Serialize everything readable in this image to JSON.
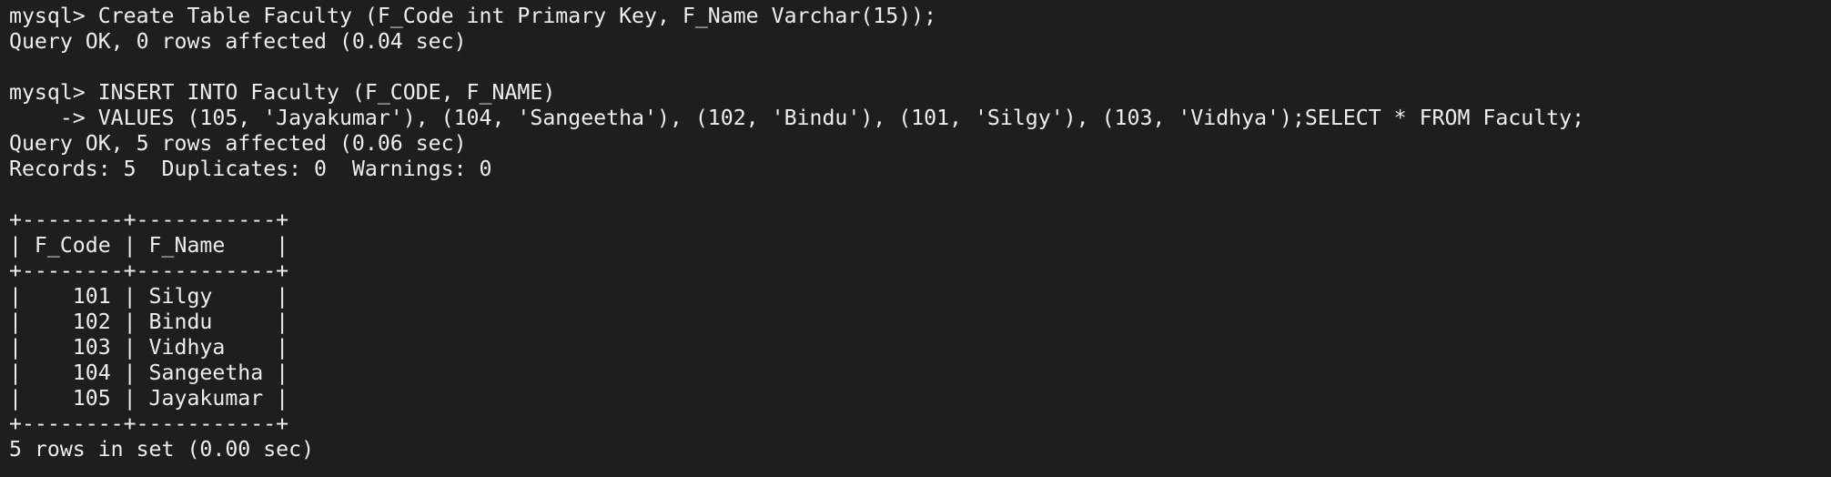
{
  "terminal": {
    "lines": [
      "mysql> Create Table Faculty (F_Code int Primary Key, F_Name Varchar(15));",
      "Query OK, 0 rows affected (0.04 sec)",
      "",
      "mysql> INSERT INTO Faculty (F_CODE, F_NAME)",
      "    -> VALUES (105, 'Jayakumar'), (104, 'Sangeetha'), (102, 'Bindu'), (101, 'Silgy'), (103, 'Vidhya');SELECT * FROM Faculty;",
      "Query OK, 5 rows affected (0.06 sec)",
      "Records: 5  Duplicates: 0  Warnings: 0",
      "",
      "+--------+-----------+",
      "| F_Code | F_Name    |",
      "+--------+-----------+",
      "|    101 | Silgy     |",
      "|    102 | Bindu     |",
      "|    103 | Vidhya    |",
      "|    104 | Sangeetha |",
      "|    105 | Jayakumar |",
      "+--------+-----------+",
      "5 rows in set (0.00 sec)"
    ]
  }
}
